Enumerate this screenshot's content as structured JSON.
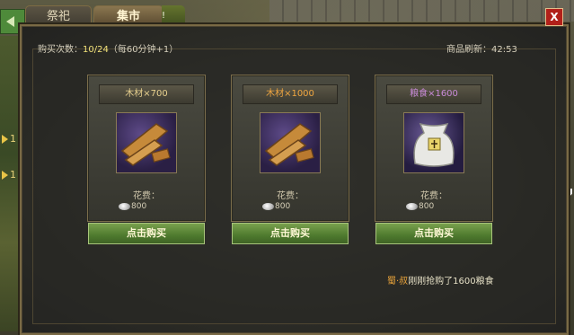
{
  "tabs": [
    {
      "label": "祭祀"
    },
    {
      "label": "集市"
    }
  ],
  "tab_extra": "!",
  "close_label": "X",
  "buy_count": {
    "label": "购买次数：",
    "value": "10/24",
    "note": "（每60分钟+1）"
  },
  "refresh": {
    "label": "商品刷新：",
    "time": "42:53"
  },
  "cards": [
    {
      "name": "木材×700",
      "cost_label": "花费：",
      "price": "800",
      "button": "点击购买"
    },
    {
      "name": "木材×1000",
      "cost_label": "花费：",
      "price": "800",
      "button": "点击购买"
    },
    {
      "name": "粮食×1600",
      "cost_label": "花费：",
      "price": "800",
      "button": "点击购买"
    }
  ],
  "announcement": {
    "player": "蜀·叔",
    "text": "刚刚抢购了1600粮食"
  },
  "side_labels": [
    "1",
    "1"
  ],
  "colors": {
    "buy_button": "#4e7a2e",
    "close": "#b1201a",
    "food_name": "#c88ad8",
    "wood_name_highlight": "#f0a640"
  }
}
